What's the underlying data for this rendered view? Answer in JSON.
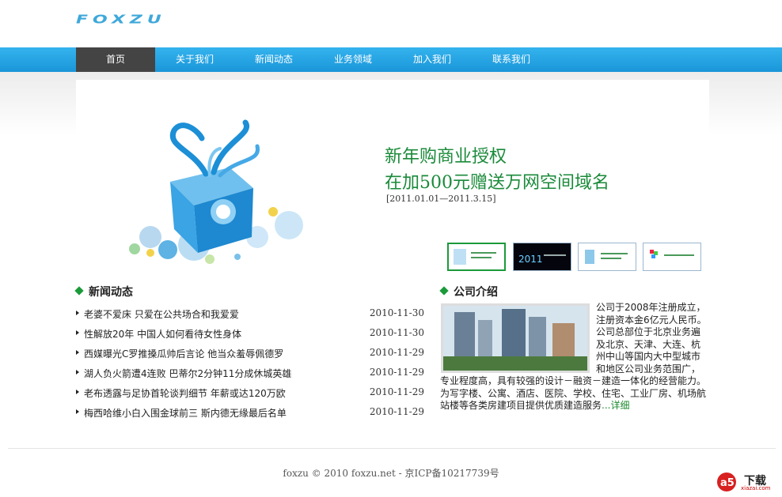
{
  "logo": "FOXZU",
  "nav": {
    "items": [
      {
        "label": "首页",
        "active": true
      },
      {
        "label": "关于我们"
      },
      {
        "label": "新闻动态"
      },
      {
        "label": "业务领域"
      },
      {
        "label": "加入我们"
      },
      {
        "label": "联系我们"
      }
    ]
  },
  "banner": {
    "line1": "新年购商业授权",
    "line2": "在加500元赠送万网空间域名",
    "date": "[2011.01.01—2011.3.15]"
  },
  "news": {
    "title": "新闻动态",
    "items": [
      {
        "title": "老婆不爱床 只爱在公共场合和我爱爱",
        "date": "2010-11-30"
      },
      {
        "title": "性解放20年 中国人如何看待女性身体",
        "date": "2010-11-30"
      },
      {
        "title": "西媒曝光C罗推搡瓜帅后言论 他当众羞辱佩德罗",
        "date": "2010-11-29"
      },
      {
        "title": "湖人负火箭遭4连败 巴蒂尔2分钟11分成休城英雄",
        "date": "2010-11-29"
      },
      {
        "title": "老布透露与足协首轮谈判细节 年薪或达120万欧",
        "date": "2010-11-29"
      },
      {
        "title": "梅西哈维小白入围金球前三 斯内德无缘最后名单",
        "date": "2010-11-29"
      }
    ]
  },
  "company": {
    "title": "公司介绍",
    "text": "公司于2008年注册成立，注册资本金6亿元人民币。公司总部位于北京业务遍及北京、天津、大连、杭州中山等国内大中型城市和地区公司业务范围广，专业程度高，具有较强的设计－融资－建造一体化的经营能力。为写字楼、公寓、酒店、医院、学校、住宅、工业厂房、机场航站楼等各类房建项目提供优质建造服务",
    "more": "...详细"
  },
  "footer": "foxzu  © 2010 foxzu.net - 京ICP备10217739号",
  "watermark": {
    "main": "下载",
    "sub": "xiazai.com"
  },
  "colors": {
    "nav": "#1ea5e6",
    "accent_green": "#1b9a3a",
    "active_nav": "#444444"
  }
}
